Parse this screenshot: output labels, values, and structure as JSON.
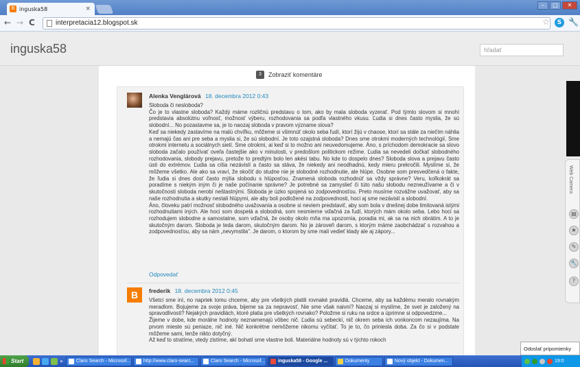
{
  "browser": {
    "tab_title": "inguska58",
    "tab_close": "×",
    "url": "interpretacia12.blogspot.sk",
    "back": "←",
    "forward": "→",
    "reload": "C",
    "star": "☆",
    "skype": "S"
  },
  "blog": {
    "title": "inguska58",
    "search_placeholder": "hľadať"
  },
  "comments_toggle": {
    "count": "3",
    "label": "Zobraziť komentáre"
  },
  "comments": [
    {
      "author": "Alenka Venglárová",
      "date": "18. decembra 2012 0:43",
      "paragraphs": [
        "Sloboda či nesloboda?",
        "Čo je to vlastne sloboda? Každý máme rozličnú predstavu o tom, ako by mala sloboda vyzerať. Pod týmto slovom si mnohí predstavia absolútnu voľnosť, možnosť výberu, rozhodovania sa podľa vlastného vkusu. Ľudia si dnes často myslia, že sú slobodní... No pozastavme sa, je to naozaj sloboda v pravom význame slova?",
        "Keď sa niekedy zastavíme na malú chvíľku, môžeme si všimnúť okolo seba ľudí, ktorí žijú v chaose, ktorí sa stále za niečím náhlia a nemajú čas ani pre seba a myslia si, že sú slobodní. Je toto ozajstná sloboda? Dnes sme otrokmi moderných technológií. Sme otrokmi internetu a sociálnych sietí. Sme otrokmi, ai keď si to možno ani neuvedomujeme. Áno, s príchodom demokracie sa slovo sloboda začalo používať oveľa častejšie ako v minulosti, v predošlom politickom režime. Ľudia sa nevedeli dočkať slobodného rozhodovania, slobody prejavu, pretože to predtým bolo len akési tabu. No kde to dospelo dnes? Sloboda slova a prejavu často ústi do extrémov. Ľudia sa cítia nezávislí a často sa stáva, že niekedy ani neodhadnú, kedy mieru prekročili. Myslíme si, že môžeme všetko. Ale ako sa vraví, že skočiť do studne nie je slobodné rozhodnutie, ale hlúpe. Osobne som presvedčená o fakte, že ľudia si dnes dosť často mýlia slobodu s hlúposťou. Znamená sloboda rozhodnúť sa vždy správne? Veru, koľkokrát sa poradíme s niekým iným či je naše počínanie správne? Je potrebné sa zamyslieť či túto našu slobodu nezneužívame a či v skutočnosti sloboda nerobí neštastnými. Sloboda je úzko spojená so zodpovednosťou. Preto musíme rozvážne uvažovať, aby sa naše rozhodnutia a skutky nestali hlúpymi, ale aby boli podložené na zodpovednosti, hoci aj sme nezávislí a slobodní.",
        "Áno, človeku patrí možnosť slobodného uvažovania a osobne si neviem predstaviť, aby som bola v dnešnej dobe limitovaná istými rozhodnutiami iných. Ale hoci som dospelá a slobodná, som nesmierne vďačná za ľudí, ktorých mám okolo seba. Lebo hoci sa rozhodujem slobodne a samostatne, som vďačná, že osoby okolo mňa ma upozornia, poradia mi, ak sa na nich obrátim. A to je skutočným darom. Sloboda je teda darom, skutočným darom. No je zároveň darom, s ktorým máme zaobchádzať s rozvahou a zodpovednosťou, aby sa nám „nevymstila\". Je darom, o ktorom by sme mali vedieť klady ale aj zápory..."
      ],
      "reply": "Odpovedať"
    },
    {
      "author": "frederik",
      "date": "18. decembra 2012 0:45",
      "paragraphs": [
        "Všetci sme iní, no napriek tomu chceme, aby pre všetkých platili rovnaké pravidlá. Chceme, aby sa každému meralo rovnakým meradlom. Bojujeme za svoje práva, bijeme sa za nepravosť. Nie sme však naivní? Naozaj si myslíme, že svet je založený na spravodlivosti? Nejakých pravidlách, ktoré platia pre všetkých rovnako? Položme si ruku na srdce a úprimne si odpovedzme...",
        "Žijeme v dobe, kde morálne hodnoty neznamenajú vôbec nič. Ľudia sú sebeckí, nič okrem seba ich vonkoncom nezaujíma. Na prvom mieste sú peniaze, nič iné. Nič konkrétne nemôžeme nikomu vyčítať. To je to, čo priniesla doba. Za čo si v podstate môžeme sami, lenže nikto dotyčný.",
        "Až keď to stratíme, vtedy zistíme, akí bohatí sme vlastne boli. Materiálne hodnoty sú v týchto rokoch"
      ]
    }
  ],
  "side_gadget": {
    "label": "Web Camera"
  },
  "notice": "Odoslať pripomienky",
  "taskbar": {
    "start": "Start",
    "chevron": "»",
    "buttons": [
      "Claro Search - Microsof...",
      "http://www.claro-searc...",
      "Claro Search - Microsof...",
      "inguska58 - Google ...",
      "Dokumenty",
      "Nový objekt - Dokumen..."
    ],
    "clock": "19:0"
  }
}
